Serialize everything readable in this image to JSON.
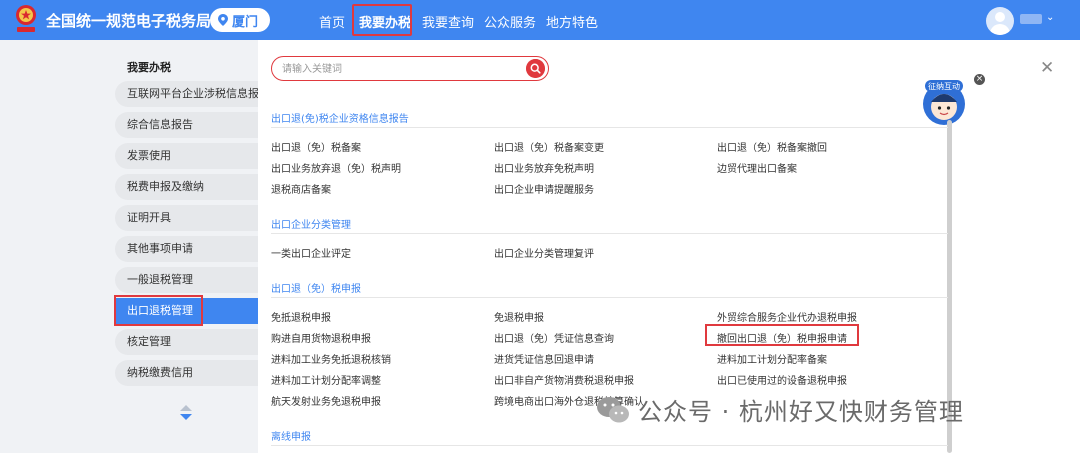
{
  "header": {
    "title": "全国统一规范电子税务局",
    "city": "厦门",
    "nav": [
      "首页",
      "我要办税",
      "我要查询",
      "公众服务",
      "地方特色"
    ],
    "active_nav": "我要办税",
    "brand_color": "#3f86f0"
  },
  "sidebar": {
    "title": "我要办税",
    "items": [
      {
        "label": "互联网平台企业涉税信息报送",
        "active": false
      },
      {
        "label": "综合信息报告",
        "active": false
      },
      {
        "label": "发票使用",
        "active": false
      },
      {
        "label": "税费申报及缴纳",
        "active": false
      },
      {
        "label": "证明开具",
        "active": false
      },
      {
        "label": "其他事项申请",
        "active": false
      },
      {
        "label": "一般退税管理",
        "active": false
      },
      {
        "label": "出口退税管理",
        "active": true
      },
      {
        "label": "核定管理",
        "active": false
      },
      {
        "label": "纳税缴费信用",
        "active": false
      }
    ]
  },
  "search": {
    "placeholder": "请输入关键词"
  },
  "sections": [
    {
      "title": "出口退(免)税企业资格信息报告",
      "rows": [
        [
          "出口退（免）税备案",
          "出口退（免）税备案变更",
          "出口退（免）税备案撤回"
        ],
        [
          "出口业务放弃退（免）税声明",
          "出口业务放弃免税声明",
          "边贸代理出口备案"
        ],
        [
          "退税商店备案",
          "出口企业申请提醒服务",
          ""
        ]
      ]
    },
    {
      "title": "出口企业分类管理",
      "rows": [
        [
          "一类出口企业评定",
          "出口企业分类管理复评",
          ""
        ]
      ]
    },
    {
      "title": "出口退（免）税申报",
      "rows": [
        [
          "免抵退税申报",
          "免退税申报",
          "外贸综合服务企业代办退税申报"
        ],
        [
          "购进自用货物退税申报",
          "出口退（免）凭证信息查询",
          "撤回出口退（免）税申报申请"
        ],
        [
          "进料加工业务免抵退税核销",
          "进货凭证信息回退申请",
          "进料加工计划分配率备案"
        ],
        [
          "进料加工计划分配率调整",
          "出口非自产货物消费税退税申报",
          "出口已使用过的设备退税申报"
        ],
        [
          "航天发射业务免退税申报",
          "跨境电商出口海外仓退税核算确认",
          ""
        ]
      ]
    },
    {
      "title": "离线申报",
      "rows": []
    }
  ],
  "highlighted_item": "撤回出口退（免）税申报申请",
  "float_badge": {
    "text": "征纳互动"
  },
  "watermark": {
    "text": "公众号 · 杭州好又快财务管理"
  },
  "colors": {
    "highlight_border": "#e0393e",
    "section_title": "#3f86f0"
  }
}
